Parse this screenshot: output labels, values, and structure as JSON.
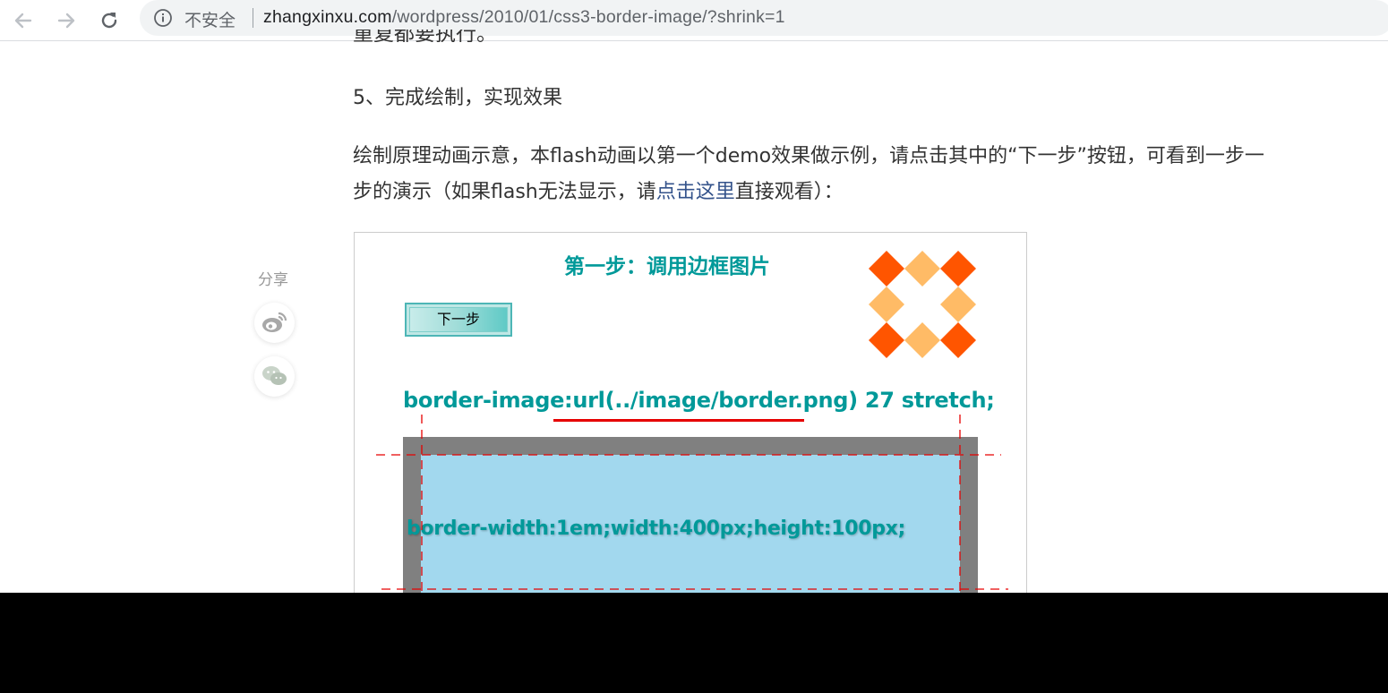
{
  "browser": {
    "security_label": "不安全",
    "url_host": "zhangxinxu.com",
    "url_path": "/wordpress/2010/01/css3-border-image/?shrink=1"
  },
  "article": {
    "cut_line": "重复都要执行。",
    "step_heading": "5、完成绘制，实现效果",
    "paragraph_line1": "绘制原理动画示意，本flash动画以第一个demo效果做示例，请点击其中的“下一步”按钮，可看到一步一",
    "paragraph_line2_before": "步的演示（如果flash无法显示，请",
    "paragraph_link": "点击这里",
    "paragraph_line2_after": "直接观看）："
  },
  "share": {
    "label": "分享",
    "items": [
      {
        "icon": "weibo-icon"
      },
      {
        "icon": "wechat-icon"
      }
    ]
  },
  "demo": {
    "title": "第一步：调用边框图片",
    "next_button_label": "下一步",
    "css_code": "border-image:url(../image/border.png) 27 stretch;",
    "box_text": "border-width:1em;width:400px;height:100px;",
    "colors": {
      "accent": "#009999",
      "diamond_dark": "#ff5500",
      "diamond_light": "#ffbb66",
      "guide": "#e60000",
      "border_gray": "#808080",
      "content_blue": "#a2d8ee"
    }
  }
}
